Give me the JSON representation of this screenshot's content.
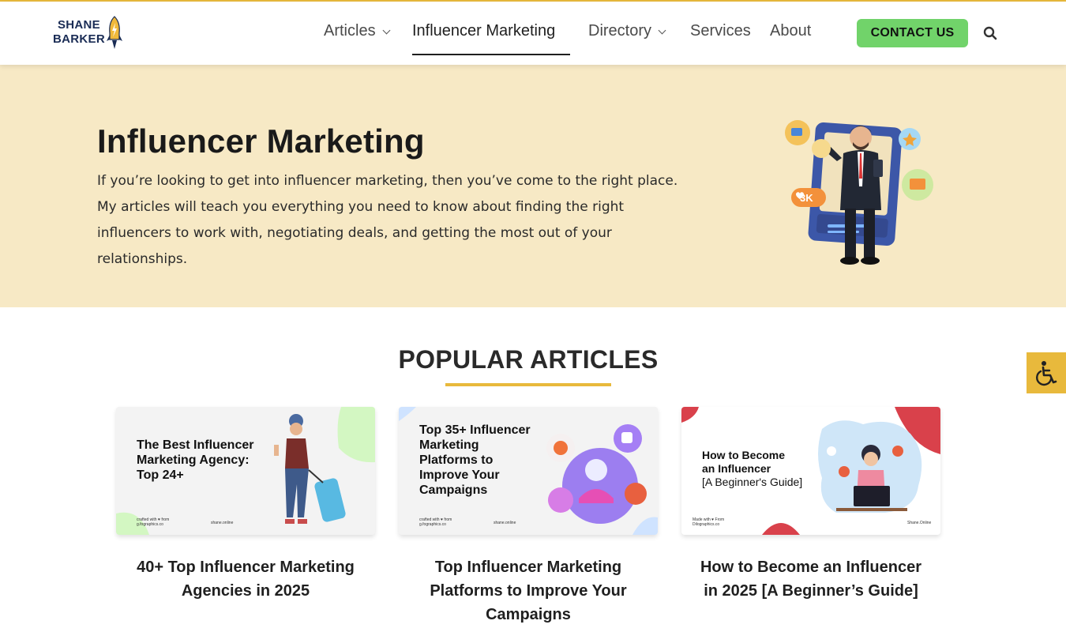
{
  "header": {
    "logo": {
      "line1": "SHANE",
      "line2": "BARKER"
    },
    "nav": [
      {
        "label": "Articles",
        "has_dropdown": true
      },
      {
        "label": "Influencer Marketing",
        "active": true
      },
      {
        "label": "Directory",
        "has_dropdown": true
      },
      {
        "label": "Services"
      },
      {
        "label": "About"
      }
    ],
    "contact_label": "CONTACT US",
    "search_icon": "search-icon"
  },
  "hero": {
    "title": "Influencer Marketing",
    "description": "If you’re looking to get into influencer marketing, then you’ve come to the right place. My articles will teach you everything you need to know about finding the right influencers to work with, negotiating deals, and getting the most out of your relationships.",
    "illustration_badge": "3K"
  },
  "popular": {
    "title": "POPULAR ARTICLES",
    "cards": [
      {
        "image_headline": "The Best Influencer Marketing Agency: Top 24+",
        "image_credit": "crafted with ♥ from g.fographics.co",
        "image_site": "shane.online",
        "title": "40+ Top Influencer Marketing Agencies in 2025"
      },
      {
        "image_headline": "Top 35+ Influencer Marketing Platforms to Improve Your Campaigns",
        "image_credit": "crafted with ♥ from g.fographics.co",
        "image_site": "shane.online",
        "title": "Top Influencer Marketing Platforms to Improve Your Campaigns"
      },
      {
        "image_headline_line1": "How to Become",
        "image_headline_line2": "an Influencer",
        "image_headline_line3": "[A Beginner's Guide]",
        "image_credit": "Made with ♥ From Dilographics.co",
        "image_site": "Shane.Online",
        "title": "How to Become an Influencer in 2025 [A Beginner’s Guide]"
      }
    ]
  },
  "accessibility_icon": "wheelchair-icon",
  "colors": {
    "accent": "#e8b93c",
    "hero_bg": "#f7e9c5",
    "cta": "#71d36a",
    "logo_navy": "#1a2c55"
  }
}
